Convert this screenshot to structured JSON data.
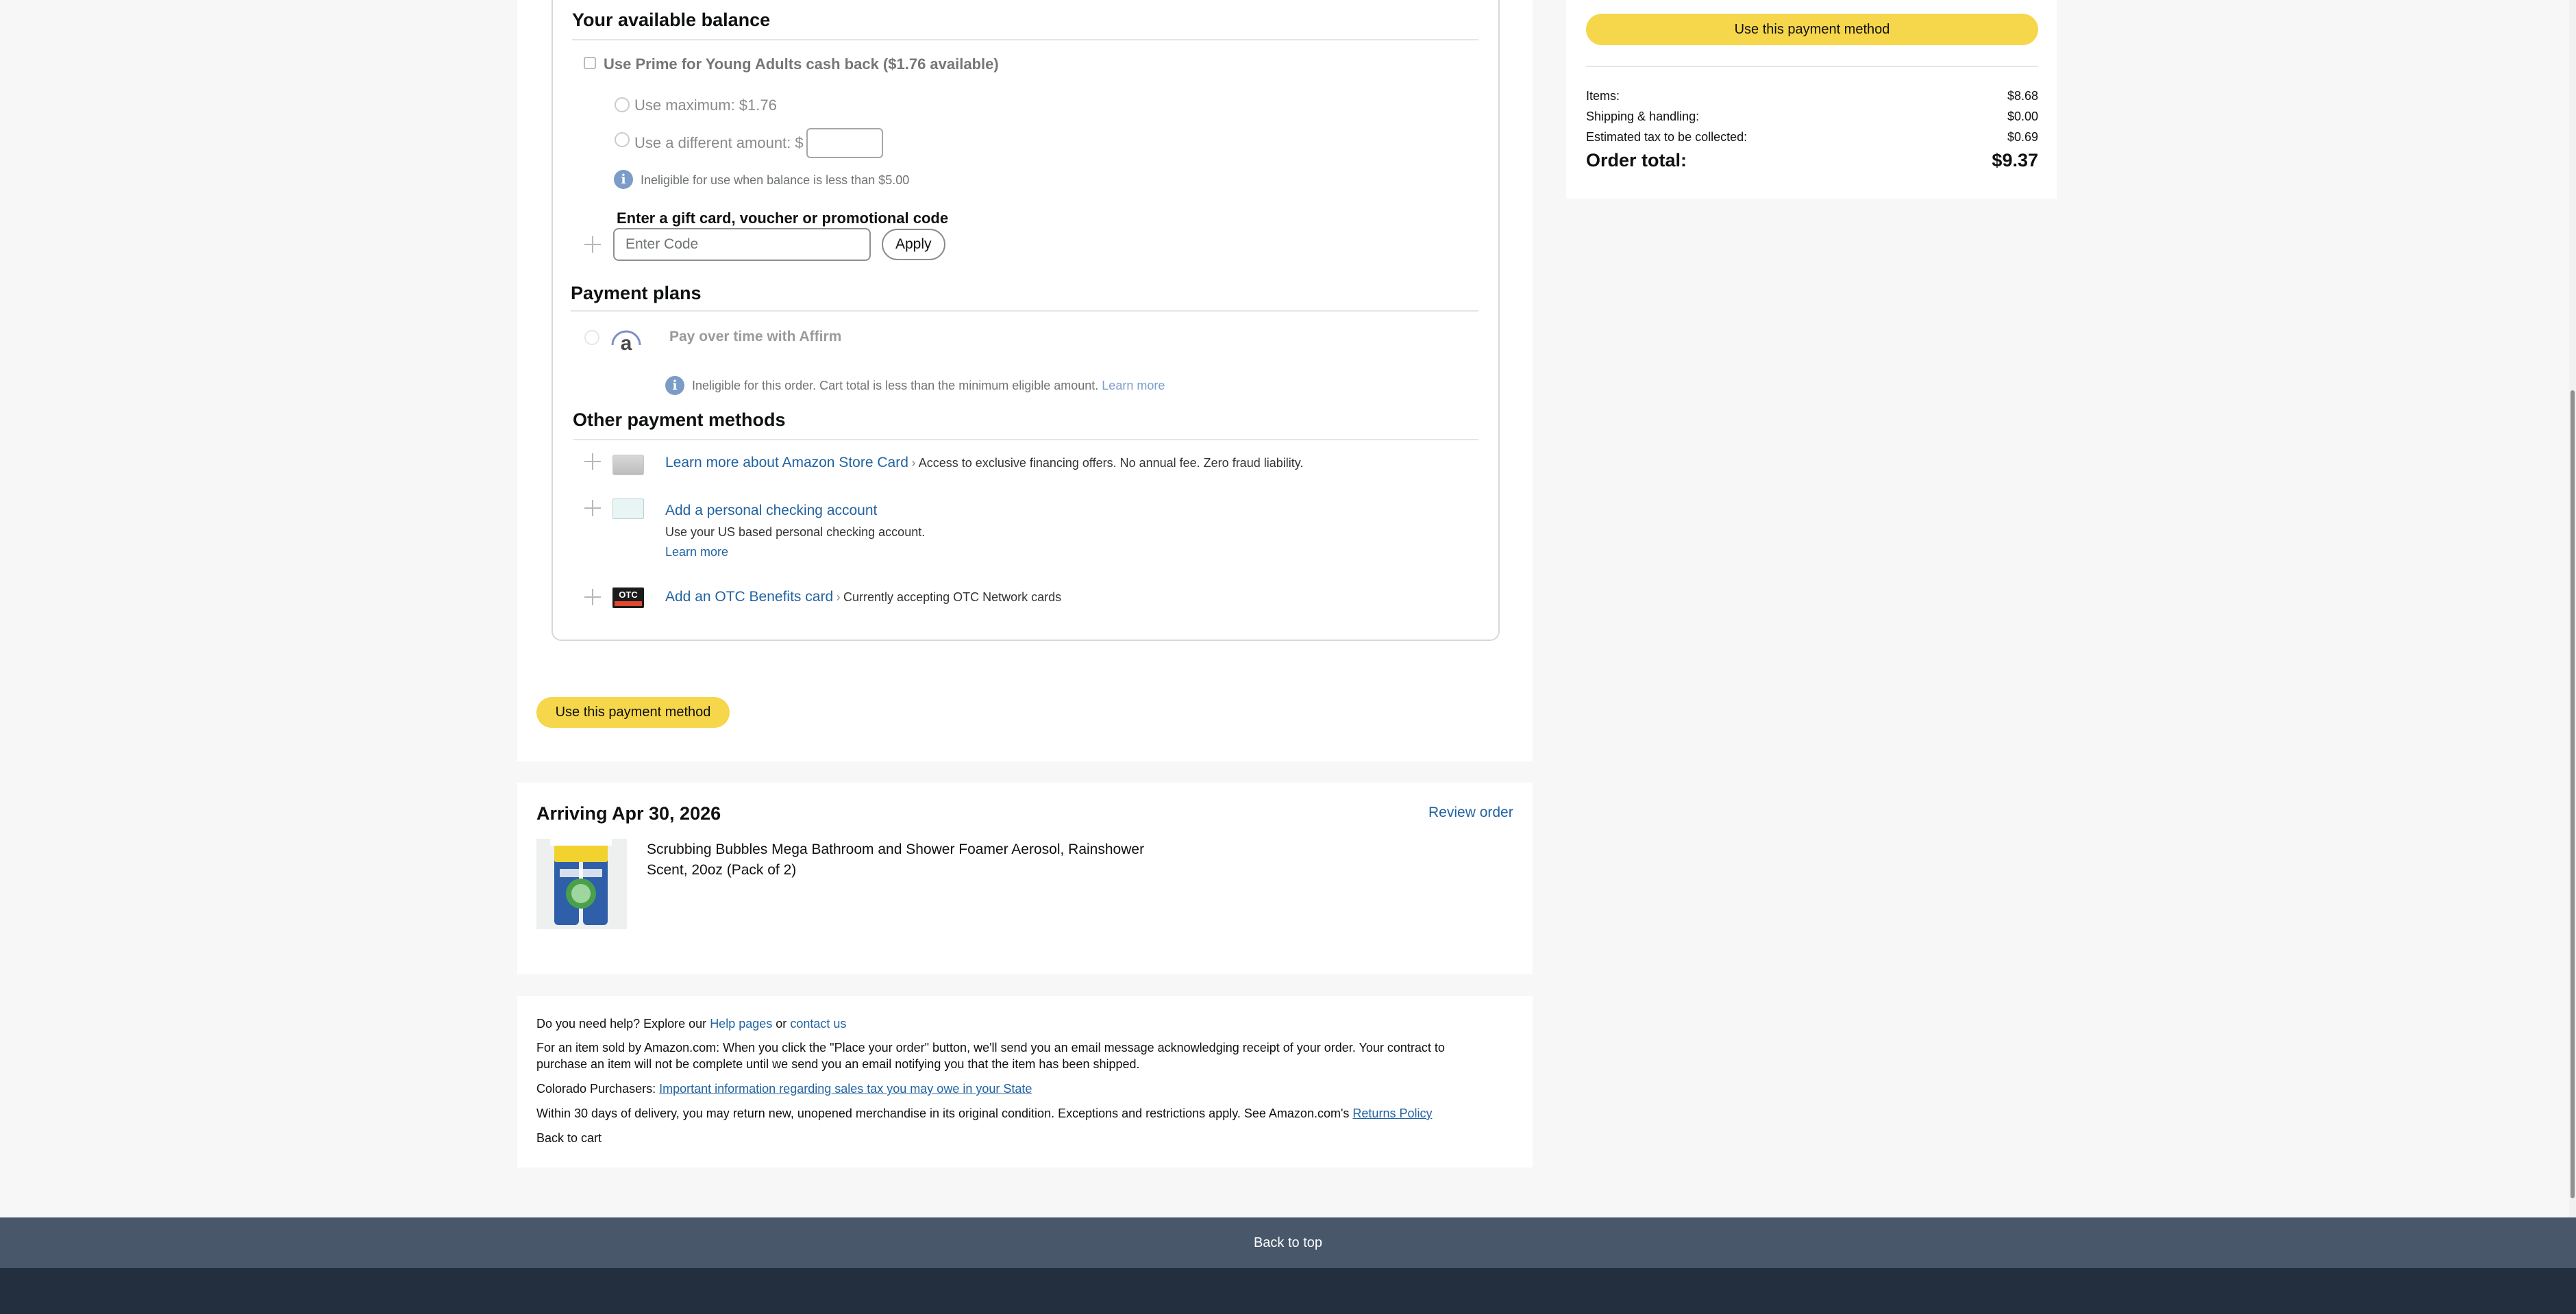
{
  "payment": {
    "balance_title": "Your available balance",
    "cashback_label": "Use Prime for Young Adults cash back ($1.76 available)",
    "use_max_label": "Use maximum: $1.76",
    "use_diff_label": "Use a different amount: $",
    "ineligible_balance": "Ineligible for use when balance is less than $5.00",
    "gift_title": "Enter a gift card, voucher or promotional code",
    "code_placeholder": "Enter Code",
    "apply_label": "Apply",
    "plans_title": "Payment plans",
    "affirm_label": "Pay over time with Affirm",
    "affirm_ineligible": "Ineligible for this order. Cart total is less than the minimum eligible amount.",
    "affirm_learn_more": "Learn more",
    "other_title": "Other payment methods",
    "store_card_link": "Learn more about Amazon Store Card",
    "store_card_desc": "Access to exclusive financing offers. No annual fee. Zero fraud liability.",
    "checking_link": "Add a personal checking account",
    "checking_desc": "Use your US based personal checking account.",
    "checking_learn_more": "Learn more",
    "otc_link": "Add an OTC Benefits card",
    "otc_desc": "Currently accepting OTC Network cards",
    "otc_logo_text": "OTC",
    "use_method_button": "Use this payment method"
  },
  "summary": {
    "use_method_button": "Use this payment method",
    "items_label": "Items:",
    "items_value": "$8.68",
    "shipping_label": "Shipping & handling:",
    "shipping_value": "$0.00",
    "tax_label": "Estimated tax to be collected:",
    "tax_value": "$0.69",
    "total_label": "Order total:",
    "total_value": "$9.37"
  },
  "arriving": {
    "title": "Arriving Apr 30, 2026",
    "review_link": "Review order",
    "product_line1": "Scrubbing Bubbles Mega Bathroom and Shower Foamer Aerosol, Rainshower",
    "product_line2": "Scent, 20oz (Pack of 2)"
  },
  "help": {
    "need_help": "Do you need help? Explore our",
    "help_pages": "Help pages",
    "or": "or",
    "contact_us": "contact us",
    "sold_by_line1": "For an item sold by Amazon.com: When you click the \"Place your order\" button, we'll send you an email message acknowledging receipt of your order. Your contract to",
    "sold_by_line2": "purchase an item will not be complete until we send you an email notifying you that the item has been shipped.",
    "colorado_label": "Colorado Purchasers:",
    "colorado_link": "Important information regarding sales tax you may owe in your State",
    "returns_text": "Within 30 days of delivery, you may return new, unopened merchandise in its original condition. Exceptions and restrictions apply. See Amazon.com's",
    "returns_link": "Returns Policy",
    "back_to_cart": "Back to cart"
  },
  "footer": {
    "back_to_top": "Back to top"
  }
}
